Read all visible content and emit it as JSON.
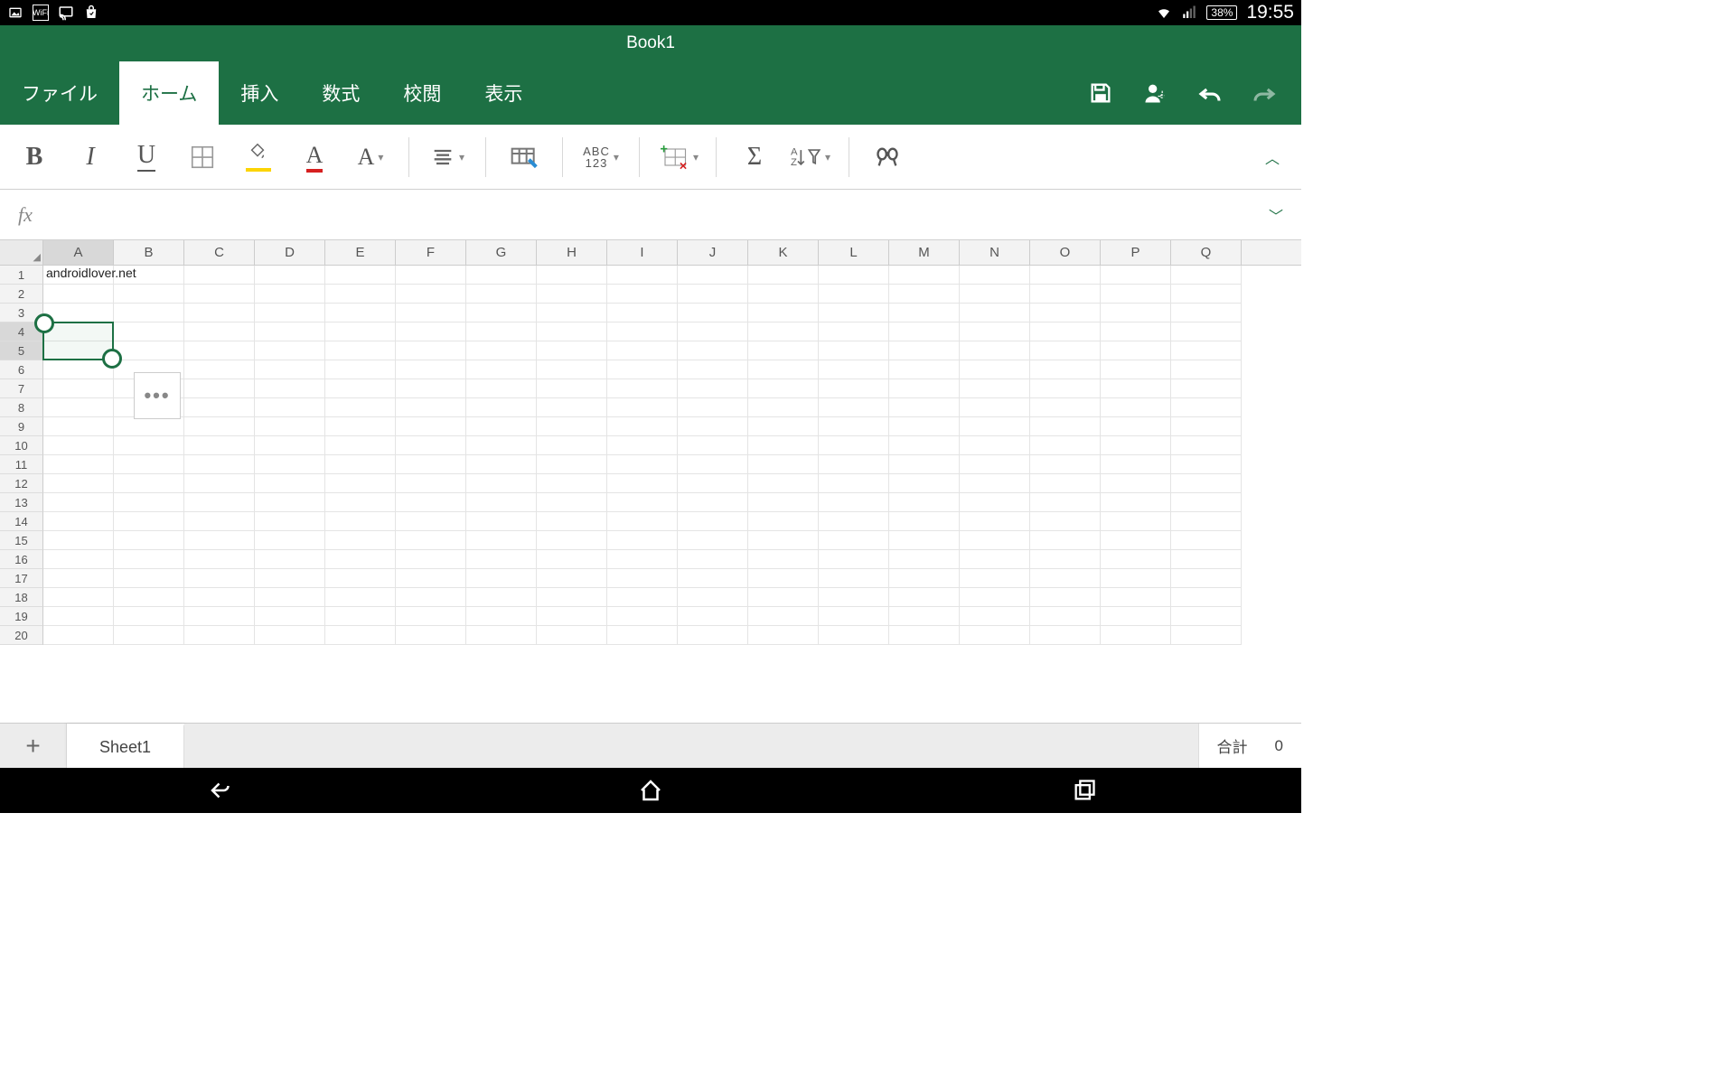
{
  "status": {
    "battery": "38%",
    "time": "19:55"
  },
  "title": "Book1",
  "ribbon": {
    "tabs": [
      {
        "label": "ファイル",
        "active": false
      },
      {
        "label": "ホーム",
        "active": true
      },
      {
        "label": "挿入",
        "active": false
      },
      {
        "label": "数式",
        "active": false
      },
      {
        "label": "校閲",
        "active": false
      },
      {
        "label": "表示",
        "active": false
      }
    ]
  },
  "toolbar": {
    "bold": "B",
    "italic": "I",
    "underline": "U",
    "fontA": "A",
    "fontColorA": "A",
    "abc": "ABC",
    "num123": "123",
    "sigma": "Σ",
    "sortAZ": "A",
    "sortZ": "Z"
  },
  "formula": {
    "fx": "fx",
    "value": ""
  },
  "columns": [
    "A",
    "B",
    "C",
    "D",
    "E",
    "F",
    "G",
    "H",
    "I",
    "J",
    "K",
    "L",
    "M",
    "N",
    "O",
    "P",
    "Q"
  ],
  "rows": [
    1,
    2,
    3,
    4,
    5,
    6,
    7,
    8,
    9,
    10,
    11,
    12,
    13,
    14,
    15,
    16,
    17,
    18,
    19,
    20
  ],
  "cells": {
    "A1": "androidlover.net"
  },
  "selection": {
    "col": "A",
    "startRow": 4,
    "endRow": 5
  },
  "sheet": {
    "name": "Sheet1",
    "agg_label": "合計",
    "agg_value": "0"
  },
  "ctx_menu": "•••"
}
